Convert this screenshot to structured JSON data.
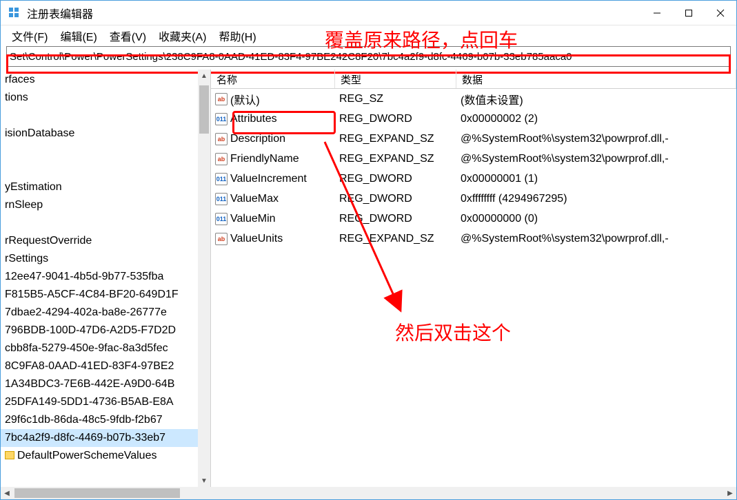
{
  "window": {
    "title": "注册表编辑器"
  },
  "menu": {
    "file": "文件(F)",
    "edit": "编辑(E)",
    "view": "查看(V)",
    "favorites": "收藏夹(A)",
    "help": "帮助(H)"
  },
  "address": {
    "value": "Set\\Control\\Power\\PowerSettings\\238C9FA8-0AAD-41ED-83F4-97BE242C8F20\\7bc4a2f9-d8fc-4469-b07b-33eb785aaca0"
  },
  "columns": {
    "name": "名称",
    "type": "类型",
    "data": "数据"
  },
  "tree": [
    "rfaces",
    "tions",
    "",
    "isionDatabase",
    "",
    "",
    "yEstimation",
    "rnSleep",
    "",
    "rRequestOverride",
    "rSettings",
    "12ee47-9041-4b5d-9b77-535fba",
    "F815B5-A5CF-4C84-BF20-649D1F",
    "7dbae2-4294-402a-ba8e-26777e",
    "796BDB-100D-47D6-A2D5-F7D2D",
    "cbb8fa-5279-450e-9fac-8a3d5fec",
    "8C9FA8-0AAD-41ED-83F4-97BE2",
    "1A34BDC3-7E6B-442E-A9D0-64B",
    "25DFA149-5DD1-4736-B5AB-E8A",
    "29f6c1db-86da-48c5-9fdb-f2b67",
    "7bc4a2f9-d8fc-4469-b07b-33eb7",
    "DefaultPowerSchemeValues"
  ],
  "tree_selected_index": 20,
  "rows": [
    {
      "icon": "sz",
      "name": "(默认)",
      "type": "REG_SZ",
      "data": "(数值未设置)"
    },
    {
      "icon": "dw",
      "name": "Attributes",
      "type": "REG_DWORD",
      "data": "0x00000002 (2)"
    },
    {
      "icon": "sz",
      "name": "Description",
      "type": "REG_EXPAND_SZ",
      "data": "@%SystemRoot%\\system32\\powrprof.dll,-"
    },
    {
      "icon": "sz",
      "name": "FriendlyName",
      "type": "REG_EXPAND_SZ",
      "data": "@%SystemRoot%\\system32\\powrprof.dll,-"
    },
    {
      "icon": "dw",
      "name": "ValueIncrement",
      "type": "REG_DWORD",
      "data": "0x00000001 (1)"
    },
    {
      "icon": "dw",
      "name": "ValueMax",
      "type": "REG_DWORD",
      "data": "0xffffffff (4294967295)"
    },
    {
      "icon": "dw",
      "name": "ValueMin",
      "type": "REG_DWORD",
      "data": "0x00000000 (0)"
    },
    {
      "icon": "sz",
      "name": "ValueUnits",
      "type": "REG_EXPAND_SZ",
      "data": "@%SystemRoot%\\system32\\powrprof.dll,-"
    }
  ],
  "annotations": {
    "top": "覆盖原来路径，点回车",
    "bottom": "然后双击这个"
  }
}
